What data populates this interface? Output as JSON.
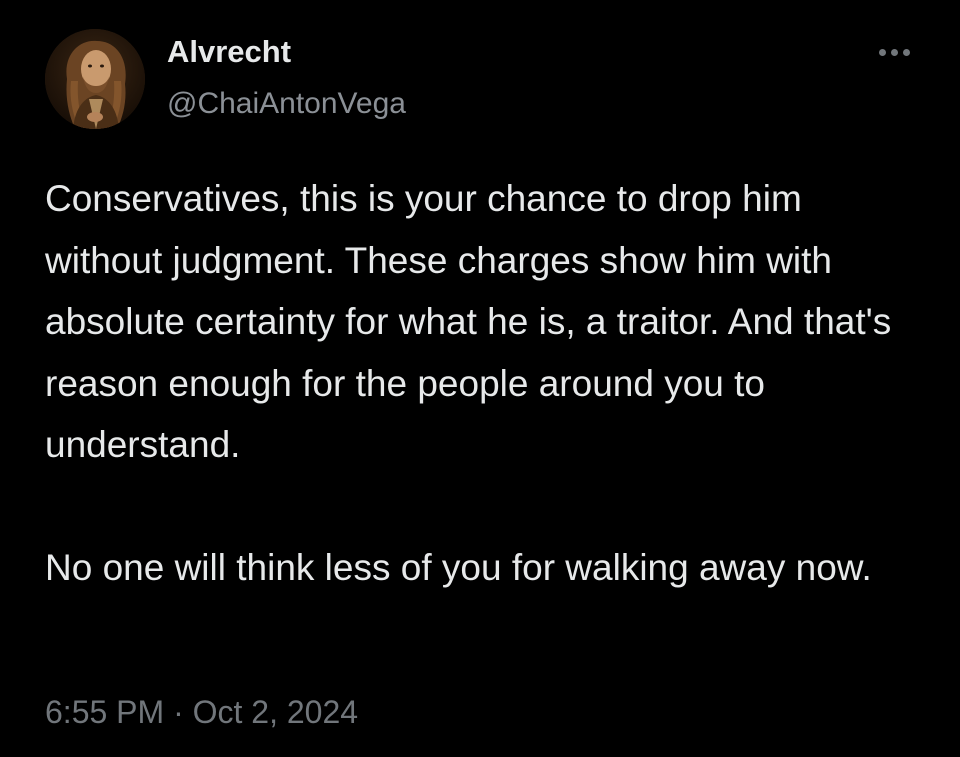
{
  "author": {
    "display_name": "Alvrecht",
    "handle": "@ChaiAntonVega",
    "avatar_icon": "portrait-avatar"
  },
  "tweet": {
    "paragraphs": [
      "Conservatives, this is your chance to drop him without judgment. These charges show him with absolute certainty for what he is, a traitor. And that's reason enough for the people around you to understand.",
      "No one will think less of you for walking away now."
    ],
    "timestamp": "6:55 PM · Oct 2, 2024"
  },
  "actions": {
    "more_icon": "more-options-icon"
  },
  "colors": {
    "background": "#000000",
    "primary_text": "#e7e9ea",
    "secondary_text": "#71767b"
  }
}
